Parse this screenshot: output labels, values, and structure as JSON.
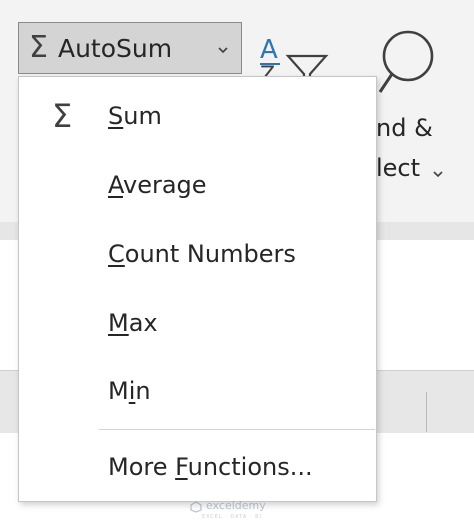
{
  "ribbon": {
    "autosum": {
      "label": "AutoSum"
    },
    "find_select": {
      "line1": "nd &",
      "line2": "lect"
    }
  },
  "menu": {
    "items": [
      {
        "mnemonic": "S",
        "rest": "um"
      },
      {
        "mnemonic": "A",
        "rest": "verage"
      },
      {
        "mnemonic": "C",
        "rest": "ount Numbers"
      },
      {
        "mnemonic": "M",
        "rest": "ax"
      },
      {
        "before": "M",
        "mnemonic": "i",
        "rest": "n"
      },
      {
        "before": "More ",
        "mnemonic": "F",
        "rest": "unctions..."
      }
    ]
  },
  "watermark": {
    "brand": "exceldemy",
    "tagline": "EXCEL · DATA · BI"
  },
  "colors": {
    "button_pressed": "#d4d4d4",
    "sort_accent": "#2e75b6",
    "menu_background": "#ffffff"
  },
  "icons": [
    "sigma-icon",
    "chevron-down-icon",
    "sort-filter-icon",
    "magnifier-icon"
  ]
}
